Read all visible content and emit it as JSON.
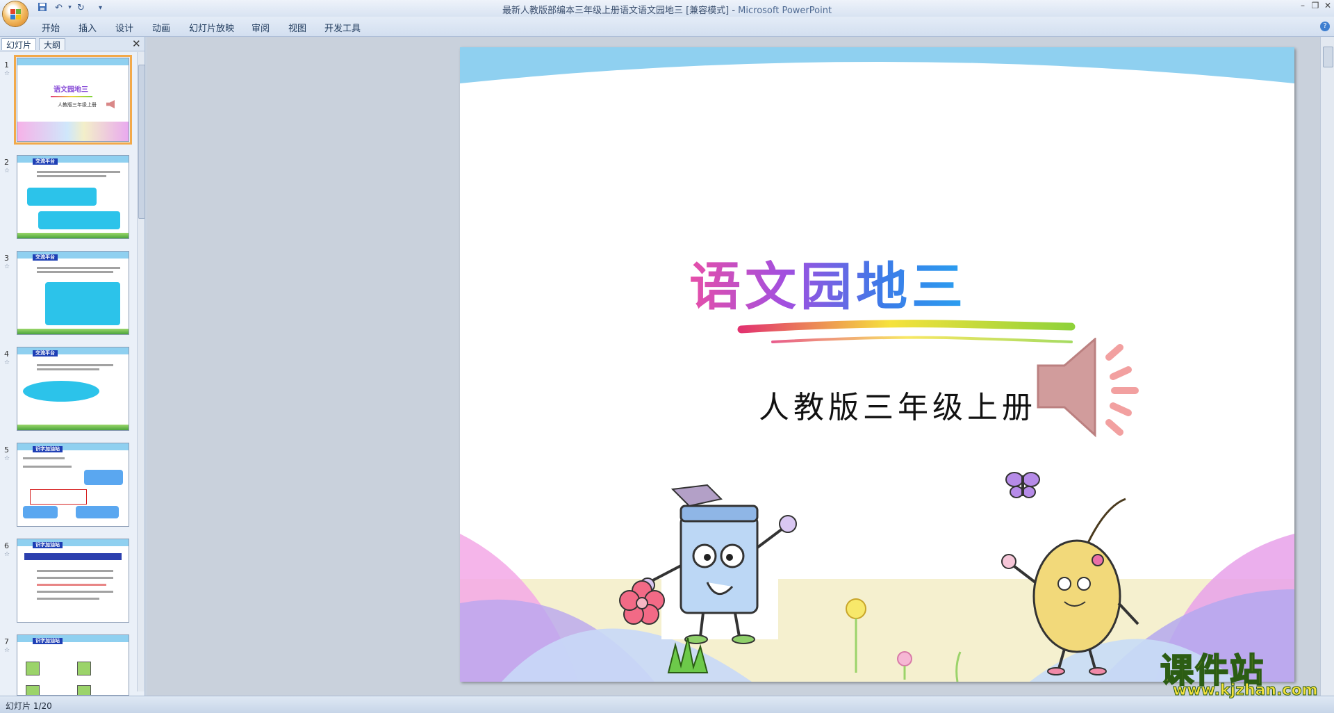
{
  "window": {
    "title": "最新人教版部编本三年级上册语文语文园地三 [兼容模式] - ",
    "app_name": "Microsoft PowerPoint"
  },
  "ribbon": {
    "tabs": [
      "开始",
      "插入",
      "设计",
      "动画",
      "幻灯片放映",
      "审阅",
      "视图",
      "开发工具"
    ]
  },
  "left_pane": {
    "tabs": [
      "幻灯片",
      "大纲"
    ],
    "thumbnails": [
      {
        "num": "1",
        "header": "语文园地三",
        "sub": "人教版三年级上册"
      },
      {
        "num": "2",
        "header": "交流平台"
      },
      {
        "num": "3",
        "header": "交流平台"
      },
      {
        "num": "4",
        "header": "交流平台"
      },
      {
        "num": "5",
        "header": "识字加油站"
      },
      {
        "num": "6",
        "header": "识字加油站"
      },
      {
        "num": "7",
        "header": "识字加油站"
      }
    ]
  },
  "slide": {
    "title": "语文园地三",
    "subtitle": "人教版三年级上册"
  },
  "status_bar": {
    "slide_info": "幻灯片 1/20"
  },
  "watermark": {
    "text": "课件站",
    "url": "www.kjzhan.com"
  },
  "icons": {
    "office": "office-button-icon",
    "save": "save-icon",
    "undo": "undo-icon",
    "redo": "redo-icon",
    "speaker": "speaker-icon"
  },
  "colors": {
    "selection": "#f2a94a",
    "slide_sky": "#8fd0f0",
    "title_gradient_start": "#e64fa8",
    "title_gradient_end": "#2aa0f0"
  }
}
